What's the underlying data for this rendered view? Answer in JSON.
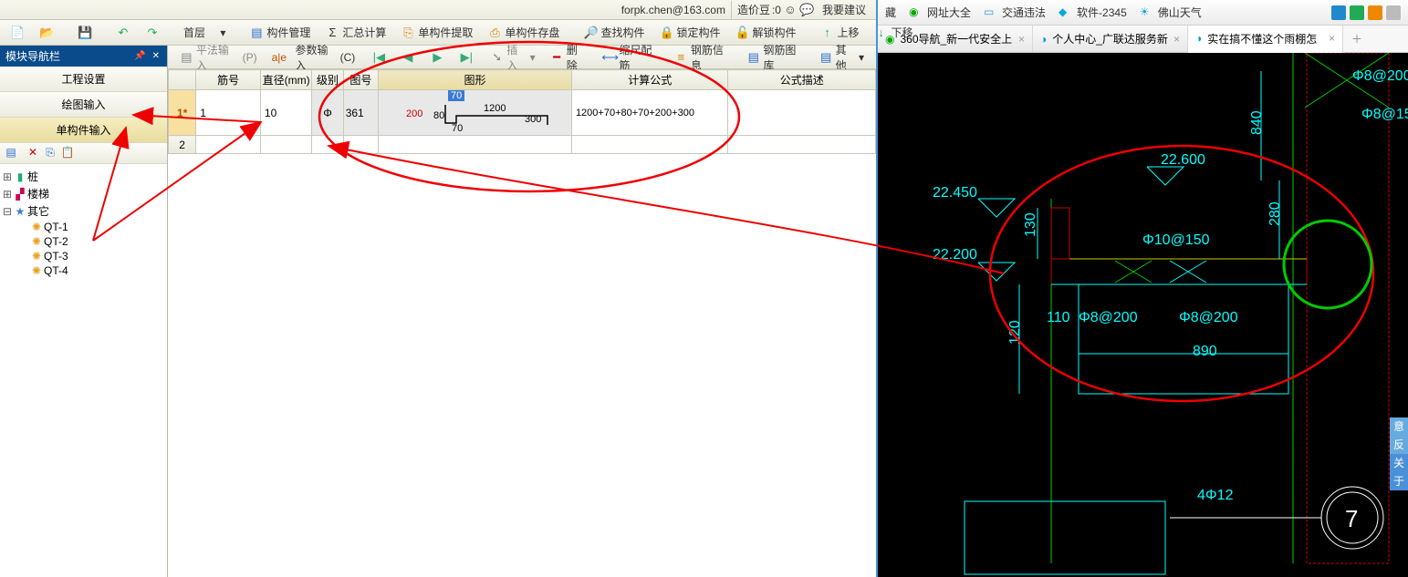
{
  "topbar": {
    "user_email": "forpk.chen@163.com",
    "credits_label": "造价豆",
    "credits_value": ":0",
    "feedback": "我要建议"
  },
  "toolbar_main": {
    "home": "首层",
    "comp_mgr": "构件管理",
    "sum_calc": "汇总计算",
    "single_extract": "单构件提取",
    "single_save": "单构件存盘",
    "find": "查找构件",
    "lock": "锁定构件",
    "unlock": "解锁构件",
    "up": "上移",
    "down": "下移"
  },
  "sidebar": {
    "title": "模块导航栏",
    "btn_project": "工程设置",
    "btn_draw": "绘图输入",
    "btn_single": "单构件输入",
    "tree": {
      "pile": "桩",
      "stair": "楼梯",
      "other": "其它",
      "children": [
        "QT-1",
        "QT-2",
        "QT-3",
        "QT-4"
      ]
    }
  },
  "grid_tb": {
    "flat_input": "平法输入",
    "param_input": "参数输入",
    "insert": "插入",
    "del": "删除",
    "scale": "缩尺配筋",
    "rebar_info": "钢筋信息",
    "rebar_lib": "钢筋图库",
    "other": "其他"
  },
  "grid": {
    "headers": [
      "筋号",
      "直径(mm)",
      "级别",
      "图号",
      "图形",
      "计算公式",
      "公式描述"
    ],
    "row_marker": "1*",
    "row2_marker": "2",
    "r1": {
      "code": "1",
      "dia": "10",
      "level": "Φ",
      "figno": "361",
      "formula": "1200+70+80+70+200+300",
      "desc": ""
    },
    "shape": {
      "d70t": "70",
      "d1200": "1200",
      "d200": "200",
      "d80": "80",
      "d70b": "70",
      "d300": "300"
    }
  },
  "browser": {
    "fav_hidden": "藏",
    "sites": "网址大全",
    "traffic": "交通违法",
    "soft": "软件-2345",
    "weather": "佛山天气",
    "tabs": [
      "360导航_新一代安全上",
      "个人中心_广联达服务新",
      "实在搞不懂这个雨棚怎"
    ]
  },
  "cad": {
    "t_22600": "22.600",
    "t_22450": "22.450",
    "t_22200": "22.200",
    "t_130": "130",
    "t_280": "280",
    "t_120": "120",
    "t_110": "110",
    "t_890": "890",
    "t_840": "840",
    "t_phi10_150": "Φ10@150",
    "t_phi8_200a": "Φ8@200",
    "t_phi8_200b": "Φ8@200",
    "t_phi8_200c": "Φ8@200",
    "t_phi8_150": "Φ8@15",
    "t_4phi12": "4Φ12",
    "t_7": "7"
  },
  "rightside": {
    "l1": "意",
    "l2": "反",
    "l3": "关",
    "l4": "于"
  }
}
